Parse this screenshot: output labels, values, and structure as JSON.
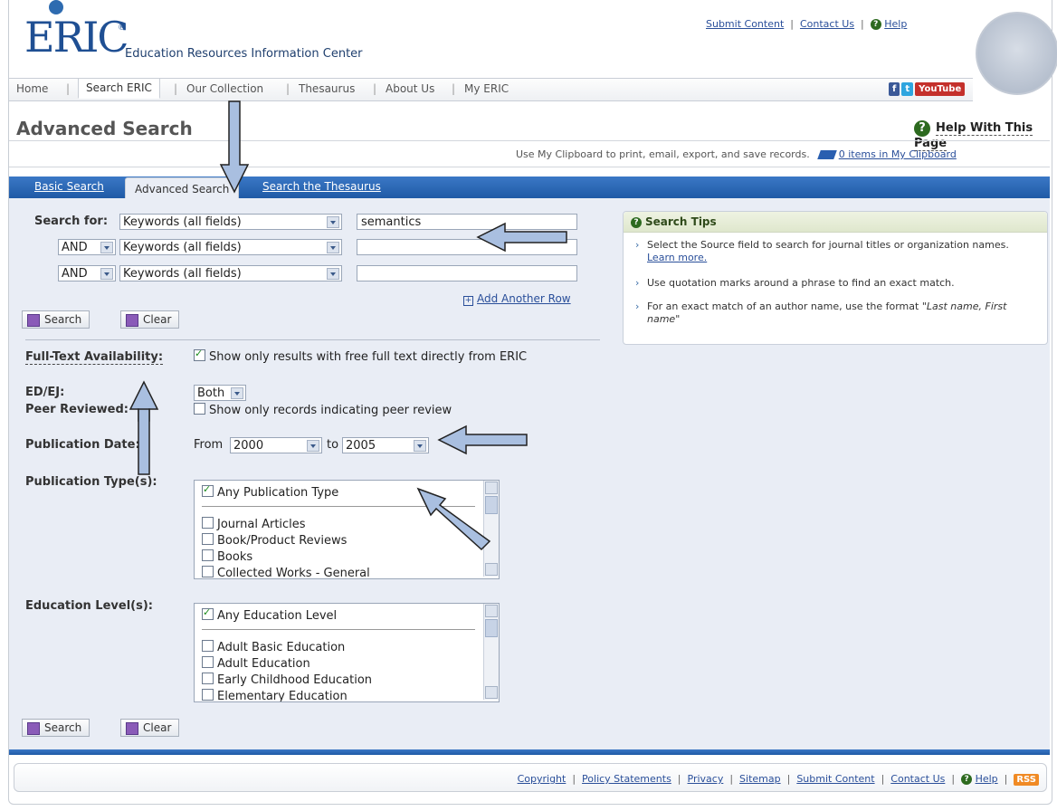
{
  "header": {
    "logo": "ERIC",
    "subtitle": "Education Resources Information Center",
    "top_links": [
      "Submit Content",
      "Contact Us",
      "Help"
    ],
    "nav": [
      "Home",
      "Search ERIC",
      "Our Collection",
      "Thesaurus",
      "About Us",
      "My ERIC"
    ],
    "social": [
      "f",
      "t",
      "YouTube"
    ]
  },
  "page": {
    "title": "Advanced Search",
    "help_link": "Help With This Page",
    "clipboard_text": "Use My Clipboard to print, email, export, and save records.",
    "clipboard_link": "0 items in My Clipboard"
  },
  "tabs": [
    "Basic Search",
    "Advanced Search",
    "Search the Thesaurus"
  ],
  "search": {
    "label": "Search for:",
    "rows": [
      {
        "operator": "",
        "field": "Keywords (all fields)",
        "value": "semantics"
      },
      {
        "operator": "AND",
        "field": "Keywords (all fields)",
        "value": ""
      },
      {
        "operator": "AND",
        "field": "Keywords (all fields)",
        "value": ""
      }
    ],
    "add_row": "Add Another Row",
    "search_button": "Search",
    "clear_button": "Clear"
  },
  "filters": {
    "fulltext_label": "Full-Text Availability:",
    "fulltext_option": "Show only results with free full text directly from ERIC",
    "edej_label": "ED/EJ:",
    "edej_value": "Both",
    "peer_label": "Peer Reviewed:",
    "peer_option": "Show only records indicating peer review",
    "pubdate_label": "Publication Date:",
    "pubdate_from_label": "From",
    "pubdate_from": "2000",
    "pubdate_to_label": "to",
    "pubdate_to": "2005",
    "pubtype_label": "Publication Type(s):",
    "pubtype_options": [
      "Any Publication Type",
      "Journal Articles",
      "Book/Product Reviews",
      "Books",
      "Collected Works - General"
    ],
    "edlevel_label": "Education Level(s):",
    "edlevel_options": [
      "Any Education Level",
      "Adult Basic Education",
      "Adult Education",
      "Early Childhood Education",
      "Elementary Education"
    ]
  },
  "tips": {
    "title": "Search Tips",
    "items": [
      "Select the Source field to search for journal titles or organization names.",
      "Use quotation marks around a phrase to find an exact match.",
      "For an exact match of an author name, use the format"
    ],
    "learn_more": "Learn more.",
    "format_example": "\"Last name, First name\""
  },
  "footer": {
    "links": [
      "Copyright",
      "Policy Statements",
      "Privacy",
      "Sitemap",
      "Submit Content",
      "Contact Us",
      "Help"
    ],
    "rss": "RSS"
  }
}
